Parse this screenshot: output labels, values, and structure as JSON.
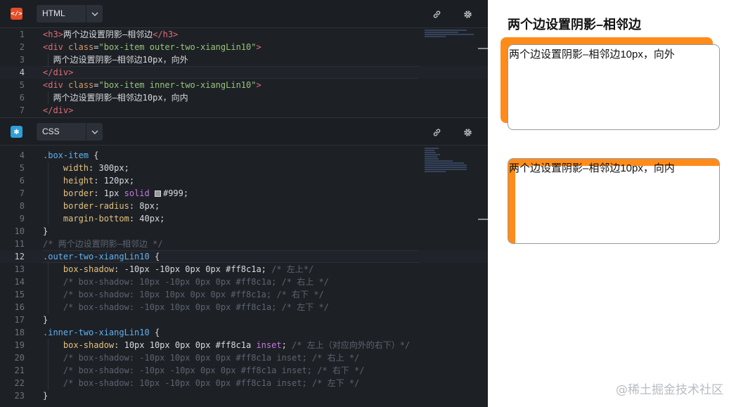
{
  "html_panel": {
    "lang": "HTML",
    "icon": "html-code-icon",
    "lines": [
      {
        "n": "1",
        "code": "<h3>两个边设置阴影–相邻边</h3>"
      },
      {
        "n": "2",
        "code": "<div class=\"box-item outer-two-xiangLin10\">"
      },
      {
        "n": "3",
        "code": "  两个边设置阴影–相邻边10px，向外"
      },
      {
        "n": "4",
        "code": "</div>"
      },
      {
        "n": "5",
        "code": "<div class=\"box-item inner-two-xiangLin10\">"
      },
      {
        "n": "6",
        "code": "  两个边设置阴影–相邻边10px，向内"
      },
      {
        "n": "7",
        "code": "</div>"
      }
    ]
  },
  "css_panel": {
    "lang": "CSS",
    "icon": "css-asterisk-icon",
    "lines": [
      {
        "n": "4",
        "code": ".box-item {"
      },
      {
        "n": "5",
        "code": "    width: 300px;"
      },
      {
        "n": "6",
        "code": "    height: 120px;"
      },
      {
        "n": "7",
        "code": "    border: 1px solid #999;"
      },
      {
        "n": "8",
        "code": "    border-radius: 8px;"
      },
      {
        "n": "9",
        "code": "    margin-bottom: 40px;"
      },
      {
        "n": "10",
        "code": "}"
      },
      {
        "n": "11",
        "code": "/* 两个边设置阴影–相邻边 */"
      },
      {
        "n": "12",
        "code": ".outer-two-xiangLin10 {"
      },
      {
        "n": "13",
        "code": "    box-shadow: -10px -10px 0px 0px #ff8c1a; /* 左上*/"
      },
      {
        "n": "14",
        "code": "    /* box-shadow: 10px -10px 0px 0px #ff8c1a; /* 右上 */"
      },
      {
        "n": "15",
        "code": "    /* box-shadow: 10px 10px 0px 0px #ff8c1a; /* 右下 */"
      },
      {
        "n": "16",
        "code": "    /* box-shadow: -10px 10px 0px 0px #ff8c1a; /* 左下 */"
      },
      {
        "n": "17",
        "code": "}"
      },
      {
        "n": "18",
        "code": ".inner-two-xiangLin10 {"
      },
      {
        "n": "19",
        "code": "    box-shadow: 10px 10px 0px 0px #ff8c1a inset; /* 左上（对应向外的右下）*/"
      },
      {
        "n": "20",
        "code": "    /* box-shadow: -10px 10px 0px 0px #ff8c1a inset; /* 右上 */"
      },
      {
        "n": "21",
        "code": "    /* box-shadow: -10px -10px 0px 0px #ff8c1a inset; /* 右下 */"
      },
      {
        "n": "22",
        "code": "    /* box-shadow: 10px -10px 0px 0px #ff8c1a inset; /* 左下 */"
      },
      {
        "n": "23",
        "code": "}"
      }
    ]
  },
  "preview": {
    "title": "两个边设置阴影–相邻边",
    "outer_text": "两个边设置阴影–相邻边10px，向外",
    "inner_text": "两个边设置阴影–相邻边10px，向内",
    "shadow_color": "#ff8c1a"
  },
  "watermark": "@稀土掘金技术社区",
  "colors": {
    "editor_bg": "#1d2126",
    "html_icon_bg": "#e44d26",
    "css_icon_bg": "#2f9fd8"
  }
}
